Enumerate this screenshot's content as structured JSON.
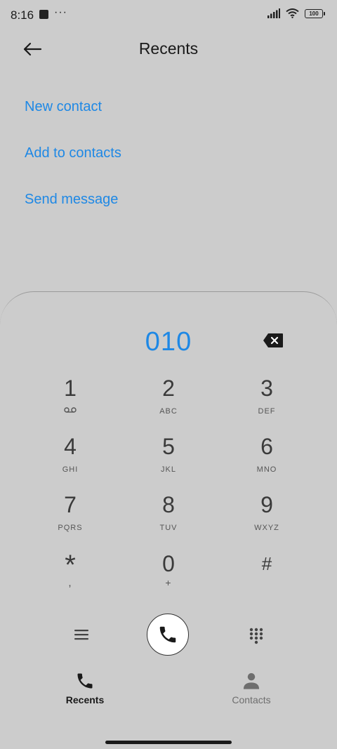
{
  "status_bar": {
    "time": "8:16",
    "dots": "···",
    "battery": "100"
  },
  "header": {
    "title": "Recents"
  },
  "actions": {
    "new_contact": "New contact",
    "add_to_contacts": "Add to contacts",
    "send_message": "Send message"
  },
  "dialpad": {
    "number": "010",
    "keys": [
      {
        "digit": "1",
        "letters": ""
      },
      {
        "digit": "2",
        "letters": "ABC"
      },
      {
        "digit": "3",
        "letters": "DEF"
      },
      {
        "digit": "4",
        "letters": "GHI"
      },
      {
        "digit": "5",
        "letters": "JKL"
      },
      {
        "digit": "6",
        "letters": "MNO"
      },
      {
        "digit": "7",
        "letters": "PQRS"
      },
      {
        "digit": "8",
        "letters": "TUV"
      },
      {
        "digit": "9",
        "letters": "WXYZ"
      },
      {
        "digit": "*",
        "letters": ","
      },
      {
        "digit": "0",
        "letters": "+"
      },
      {
        "digit": "#",
        "letters": ""
      }
    ]
  },
  "tabs": {
    "recents": "Recents",
    "contacts": "Contacts"
  },
  "colors": {
    "accent": "#1e88e5",
    "background": "#cccccc",
    "tab_inactive": "#6e6e6e"
  },
  "icons": {
    "back": "arrow-left-icon",
    "backspace": "backspace-icon",
    "voicemail": "voicemail-icon",
    "menu": "menu-lines-icon",
    "call": "phone-icon",
    "keypad": "keypad-grid-icon",
    "recents_tab": "phone-icon",
    "contacts_tab": "person-icon"
  }
}
